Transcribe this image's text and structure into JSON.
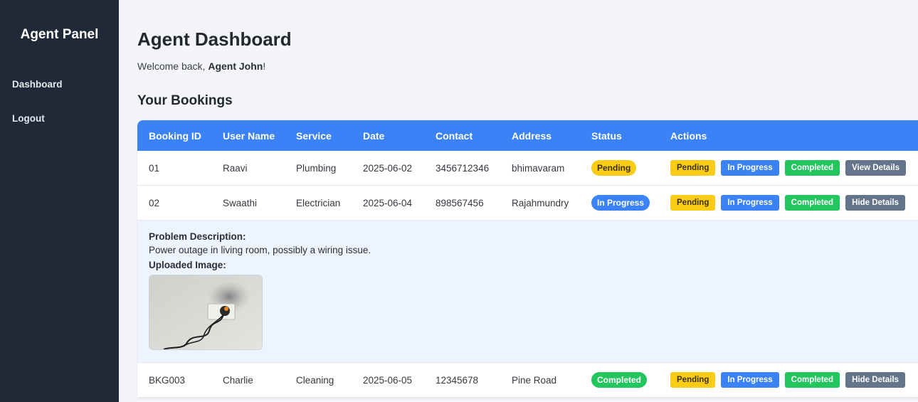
{
  "sidebar": {
    "brand": "Agent Panel",
    "items": [
      {
        "label": "Dashboard"
      },
      {
        "label": "Logout"
      }
    ]
  },
  "main": {
    "title": "Agent Dashboard",
    "welcome_prefix": "Welcome back, ",
    "welcome_name": "Agent John",
    "welcome_suffix": "!",
    "section_title": "Your Bookings"
  },
  "table": {
    "headers": [
      "Booking ID",
      "User Name",
      "Service",
      "Date",
      "Contact",
      "Address",
      "Status",
      "Actions"
    ],
    "action_labels": {
      "pending": "Pending",
      "in_progress": "In Progress",
      "completed": "Completed"
    },
    "rows": [
      {
        "id": "01",
        "user": "Raavi",
        "service": "Plumbing",
        "date": "2025-06-02",
        "contact": "3456712346",
        "address": "bhimavaram",
        "status": "Pending",
        "details_button": "View Details"
      },
      {
        "id": "02",
        "user": "Swaathi",
        "service": "Electrician",
        "date": "2025-06-04",
        "contact": "898567456",
        "address": "Rajahmundry",
        "status": "In Progress",
        "details_button": "Hide Details"
      },
      {
        "id": "BKG003",
        "user": "Charlie",
        "service": "Cleaning",
        "date": "2025-06-05",
        "contact": "12345678",
        "address": "Pine Road",
        "status": "Completed",
        "details_button": "Hide Details"
      }
    ],
    "details": {
      "problem_label": "Problem Description:",
      "problem_text": "Power outage in living room, possibly a wiring issue.",
      "image_label": "Uploaded Image:"
    }
  },
  "colors": {
    "sidebar_bg": "#1f2937",
    "header_bg": "#3b82f6",
    "pending": "#facc15",
    "in_progress": "#3b82f6",
    "completed": "#22c55e",
    "details_button": "#64748b"
  }
}
